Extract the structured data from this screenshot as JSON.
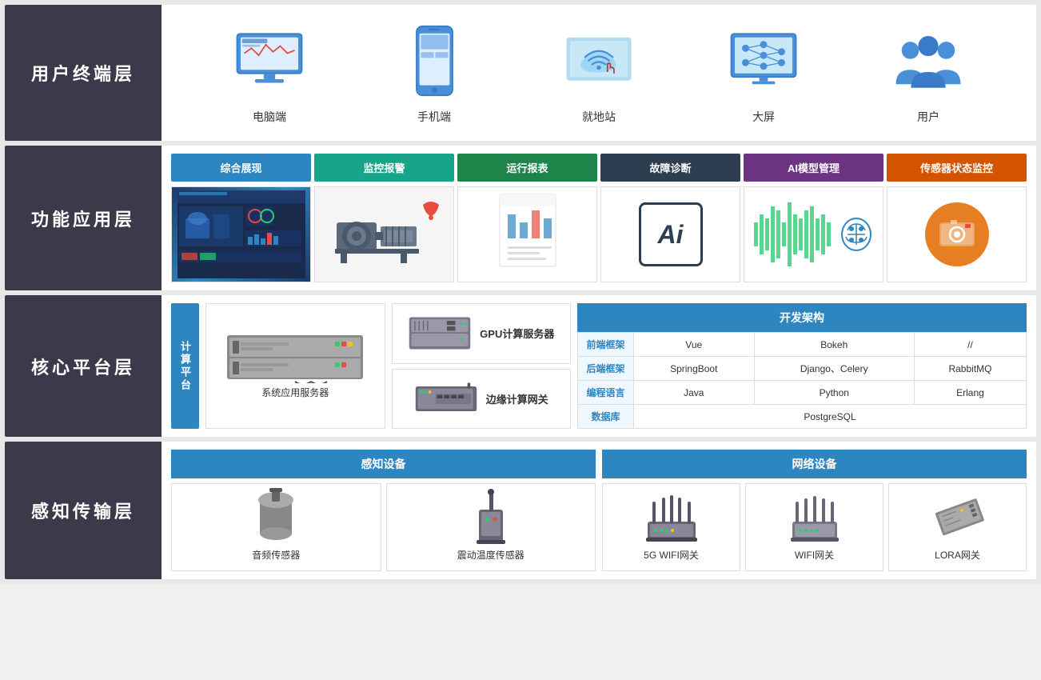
{
  "layers": [
    {
      "id": "user-terminal",
      "label": "用户终端层",
      "items": [
        {
          "id": "computer",
          "label": "电脑端",
          "icon": "computer"
        },
        {
          "id": "phone",
          "label": "手机端",
          "icon": "phone"
        },
        {
          "id": "station",
          "label": "就地站",
          "icon": "station"
        },
        {
          "id": "screen",
          "label": "大屏",
          "icon": "screen"
        },
        {
          "id": "users",
          "label": "用户",
          "icon": "users"
        }
      ]
    },
    {
      "id": "func-app",
      "label": "功能应用层",
      "tabs": [
        {
          "label": "综合展现",
          "color": "blue"
        },
        {
          "label": "监控报警",
          "color": "teal"
        },
        {
          "label": "运行报表",
          "color": "green"
        },
        {
          "label": "故障诊断",
          "color": "dark"
        },
        {
          "label": "AI模型管理",
          "color": "purple"
        },
        {
          "label": "传感器状态监控",
          "color": "orange"
        }
      ]
    },
    {
      "id": "core-platform",
      "label": "核心平台层",
      "compute_label": "计算平台",
      "system_server": "系统应用服务器",
      "gpu_server": "GPU计算服务器",
      "edge_gateway": "边缘计算网关",
      "dev_framework_title": "开发架构",
      "table": {
        "rows": [
          {
            "header": "前端框架",
            "cells": [
              "Vue",
              "Bokeh",
              "//"
            ]
          },
          {
            "header": "后端框架",
            "cells": [
              "SpringBoot",
              "Django、Celery",
              "RabbitMQ"
            ]
          },
          {
            "header": "编程语言",
            "cells": [
              "Java",
              "Python",
              "Erlang"
            ]
          },
          {
            "header": "数据库",
            "cells": [
              "PostgreSQL",
              "",
              ""
            ]
          }
        ]
      }
    },
    {
      "id": "perception",
      "label": "感知传输层",
      "perception_title": "感知设备",
      "network_title": "网络设备",
      "perception_items": [
        {
          "label": "音频传感器",
          "icon": "audio-sensor"
        },
        {
          "label": "震动温度传感器",
          "icon": "vibration-sensor"
        }
      ],
      "network_items": [
        {
          "label": "5G WIFI网关",
          "icon": "wifi-gateway-5g"
        },
        {
          "label": "WIFI网关",
          "icon": "wifi-gateway"
        },
        {
          "label": "LORA网关",
          "icon": "lora-gateway"
        }
      ]
    }
  ]
}
